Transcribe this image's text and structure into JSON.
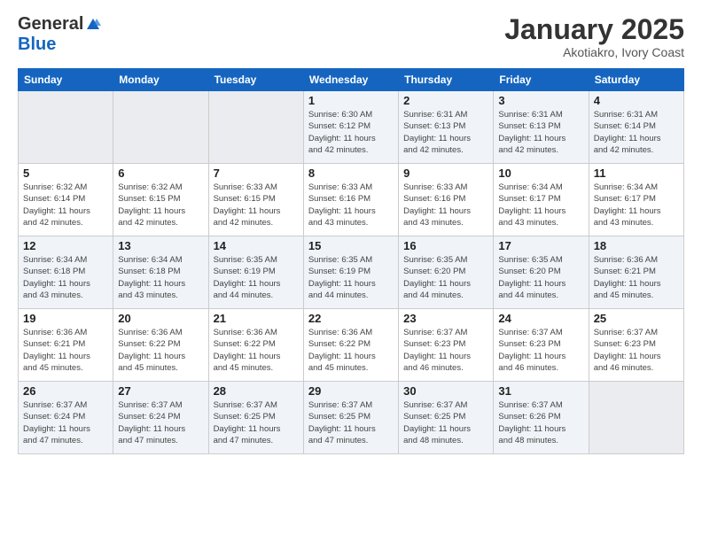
{
  "logo": {
    "general": "General",
    "blue": "Blue"
  },
  "title": "January 2025",
  "subtitle": "Akotiakro, Ivory Coast",
  "headers": [
    "Sunday",
    "Monday",
    "Tuesday",
    "Wednesday",
    "Thursday",
    "Friday",
    "Saturday"
  ],
  "weeks": [
    [
      {
        "day": "",
        "info": ""
      },
      {
        "day": "",
        "info": ""
      },
      {
        "day": "",
        "info": ""
      },
      {
        "day": "1",
        "info": "Sunrise: 6:30 AM\nSunset: 6:12 PM\nDaylight: 11 hours\nand 42 minutes."
      },
      {
        "day": "2",
        "info": "Sunrise: 6:31 AM\nSunset: 6:13 PM\nDaylight: 11 hours\nand 42 minutes."
      },
      {
        "day": "3",
        "info": "Sunrise: 6:31 AM\nSunset: 6:13 PM\nDaylight: 11 hours\nand 42 minutes."
      },
      {
        "day": "4",
        "info": "Sunrise: 6:31 AM\nSunset: 6:14 PM\nDaylight: 11 hours\nand 42 minutes."
      }
    ],
    [
      {
        "day": "5",
        "info": "Sunrise: 6:32 AM\nSunset: 6:14 PM\nDaylight: 11 hours\nand 42 minutes."
      },
      {
        "day": "6",
        "info": "Sunrise: 6:32 AM\nSunset: 6:15 PM\nDaylight: 11 hours\nand 42 minutes."
      },
      {
        "day": "7",
        "info": "Sunrise: 6:33 AM\nSunset: 6:15 PM\nDaylight: 11 hours\nand 42 minutes."
      },
      {
        "day": "8",
        "info": "Sunrise: 6:33 AM\nSunset: 6:16 PM\nDaylight: 11 hours\nand 43 minutes."
      },
      {
        "day": "9",
        "info": "Sunrise: 6:33 AM\nSunset: 6:16 PM\nDaylight: 11 hours\nand 43 minutes."
      },
      {
        "day": "10",
        "info": "Sunrise: 6:34 AM\nSunset: 6:17 PM\nDaylight: 11 hours\nand 43 minutes."
      },
      {
        "day": "11",
        "info": "Sunrise: 6:34 AM\nSunset: 6:17 PM\nDaylight: 11 hours\nand 43 minutes."
      }
    ],
    [
      {
        "day": "12",
        "info": "Sunrise: 6:34 AM\nSunset: 6:18 PM\nDaylight: 11 hours\nand 43 minutes."
      },
      {
        "day": "13",
        "info": "Sunrise: 6:34 AM\nSunset: 6:18 PM\nDaylight: 11 hours\nand 43 minutes."
      },
      {
        "day": "14",
        "info": "Sunrise: 6:35 AM\nSunset: 6:19 PM\nDaylight: 11 hours\nand 44 minutes."
      },
      {
        "day": "15",
        "info": "Sunrise: 6:35 AM\nSunset: 6:19 PM\nDaylight: 11 hours\nand 44 minutes."
      },
      {
        "day": "16",
        "info": "Sunrise: 6:35 AM\nSunset: 6:20 PM\nDaylight: 11 hours\nand 44 minutes."
      },
      {
        "day": "17",
        "info": "Sunrise: 6:35 AM\nSunset: 6:20 PM\nDaylight: 11 hours\nand 44 minutes."
      },
      {
        "day": "18",
        "info": "Sunrise: 6:36 AM\nSunset: 6:21 PM\nDaylight: 11 hours\nand 45 minutes."
      }
    ],
    [
      {
        "day": "19",
        "info": "Sunrise: 6:36 AM\nSunset: 6:21 PM\nDaylight: 11 hours\nand 45 minutes."
      },
      {
        "day": "20",
        "info": "Sunrise: 6:36 AM\nSunset: 6:22 PM\nDaylight: 11 hours\nand 45 minutes."
      },
      {
        "day": "21",
        "info": "Sunrise: 6:36 AM\nSunset: 6:22 PM\nDaylight: 11 hours\nand 45 minutes."
      },
      {
        "day": "22",
        "info": "Sunrise: 6:36 AM\nSunset: 6:22 PM\nDaylight: 11 hours\nand 45 minutes."
      },
      {
        "day": "23",
        "info": "Sunrise: 6:37 AM\nSunset: 6:23 PM\nDaylight: 11 hours\nand 46 minutes."
      },
      {
        "day": "24",
        "info": "Sunrise: 6:37 AM\nSunset: 6:23 PM\nDaylight: 11 hours\nand 46 minutes."
      },
      {
        "day": "25",
        "info": "Sunrise: 6:37 AM\nSunset: 6:23 PM\nDaylight: 11 hours\nand 46 minutes."
      }
    ],
    [
      {
        "day": "26",
        "info": "Sunrise: 6:37 AM\nSunset: 6:24 PM\nDaylight: 11 hours\nand 47 minutes."
      },
      {
        "day": "27",
        "info": "Sunrise: 6:37 AM\nSunset: 6:24 PM\nDaylight: 11 hours\nand 47 minutes."
      },
      {
        "day": "28",
        "info": "Sunrise: 6:37 AM\nSunset: 6:25 PM\nDaylight: 11 hours\nand 47 minutes."
      },
      {
        "day": "29",
        "info": "Sunrise: 6:37 AM\nSunset: 6:25 PM\nDaylight: 11 hours\nand 47 minutes."
      },
      {
        "day": "30",
        "info": "Sunrise: 6:37 AM\nSunset: 6:25 PM\nDaylight: 11 hours\nand 48 minutes."
      },
      {
        "day": "31",
        "info": "Sunrise: 6:37 AM\nSunset: 6:26 PM\nDaylight: 11 hours\nand 48 minutes."
      },
      {
        "day": "",
        "info": ""
      }
    ]
  ]
}
